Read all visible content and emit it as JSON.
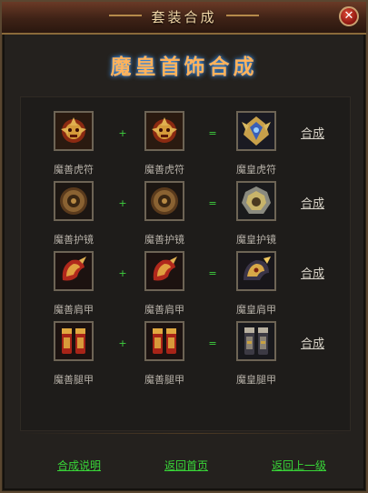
{
  "window": {
    "title": "套装合成"
  },
  "heading": "魔皇首饰合成",
  "rows": [
    {
      "input_a": "魔善虎符",
      "input_b": "魔善虎符",
      "result": "魔皇虎符",
      "plus": "+",
      "equals": "=",
      "action": "合成",
      "icon": "tiger-talisman-icon"
    },
    {
      "input_a": "魔善护镜",
      "input_b": "魔善护镜",
      "result": "魔皇护镜",
      "plus": "+",
      "equals": "=",
      "action": "合成",
      "icon": "mirror-shield-icon"
    },
    {
      "input_a": "魔善肩甲",
      "input_b": "魔善肩甲",
      "result": "魔皇肩甲",
      "plus": "+",
      "equals": "=",
      "action": "合成",
      "icon": "shoulder-armor-icon"
    },
    {
      "input_a": "魔善腿甲",
      "input_b": "魔善腿甲",
      "result": "魔皇腿甲",
      "plus": "+",
      "equals": "=",
      "action": "合成",
      "icon": "leg-armor-icon"
    }
  ],
  "footer": {
    "help": "合成说明",
    "home": "返回首页",
    "back": "返回上一级"
  },
  "colors": {
    "accent_green": "#38d638",
    "title_gold": "#f2d8a8",
    "heading_orange": "#ffb35c",
    "close_red": "#c0281c"
  }
}
